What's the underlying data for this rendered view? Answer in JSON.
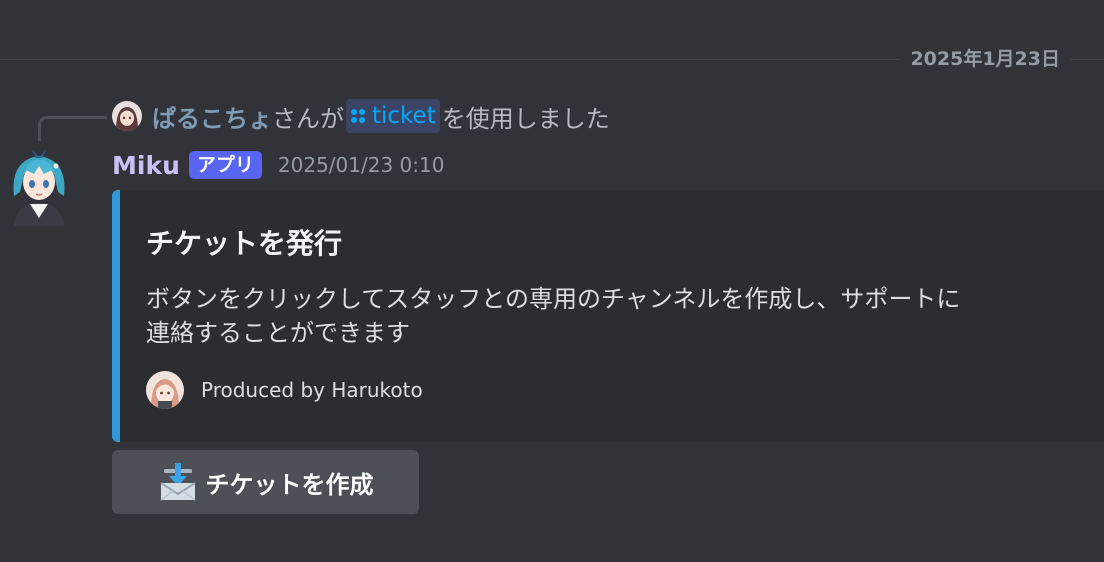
{
  "divider": {
    "date": "2025年1月23日"
  },
  "reply": {
    "user": "ぱるこちょ",
    "text_before": "さんが",
    "command": "ticket",
    "text_after": "を使用しました",
    "icon": "command-icon"
  },
  "message": {
    "author": "Miku",
    "badge": "アプリ",
    "timestamp": "2025/01/23 0:10"
  },
  "embed": {
    "accent_color": "#3298db",
    "title": "チケットを発行",
    "description_line1": "ボタンをクリックしてスタッフとの専用のチャンネルを作成し、サポートに",
    "description_line2": "連絡することができます",
    "footer": "Produced by Harukoto"
  },
  "button": {
    "icon": "inbox-tray-icon",
    "label": "チケットを作成"
  },
  "colors": {
    "background": "#313338",
    "embed_bg": "#2b2d31",
    "badge": "#5865f2",
    "link": "#00a8fc"
  }
}
